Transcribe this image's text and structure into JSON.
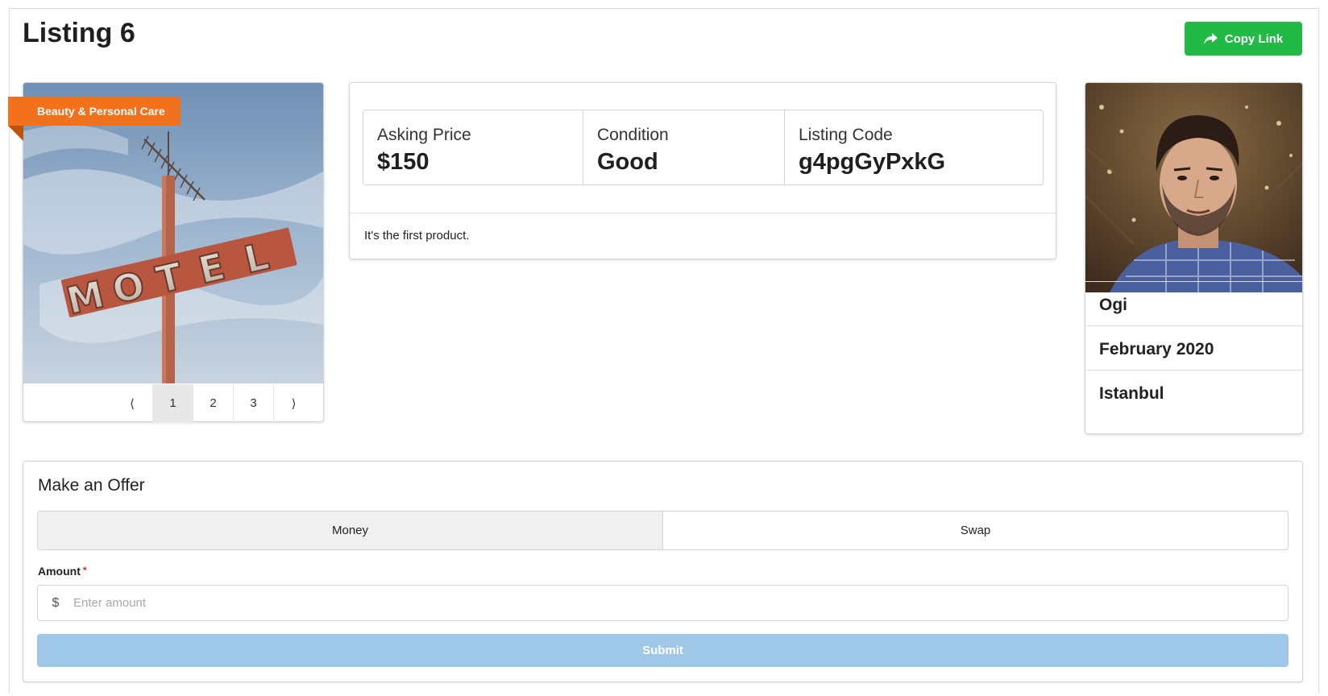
{
  "header": {
    "title": "Listing 6",
    "copy_link_label": "Copy Link",
    "copy_link_icon": "share-arrow-icon"
  },
  "colors": {
    "accent_green": "#21ba45",
    "ribbon_orange": "#f2711c",
    "submit_disabled_blue": "#9fc8e8"
  },
  "gallery": {
    "category": "Beauty & Personal Care",
    "image_description": "Vintage MOTEL sign on a pole against a blue sky",
    "pagination": {
      "prev": "⟨",
      "pages": [
        "1",
        "2",
        "3"
      ],
      "next": "⟩",
      "active_page": "1"
    }
  },
  "details": {
    "stats": [
      {
        "label": "Asking Price",
        "value": "$150"
      },
      {
        "label": "Condition",
        "value": "Good"
      },
      {
        "label": "Listing Code",
        "value": "g4pgGyPxkG"
      }
    ],
    "description": "It's the first product."
  },
  "seller": {
    "name": "Ogi",
    "joined": "February 2020",
    "location": "Istanbul"
  },
  "offer": {
    "title": "Make an Offer",
    "tabs": [
      {
        "label": "Money",
        "active": true
      },
      {
        "label": "Swap",
        "active": false
      }
    ],
    "amount_label": "Amount",
    "required_mark": "*",
    "currency_symbol": "$",
    "amount_value": "",
    "amount_placeholder": "Enter amount",
    "submit_label": "Submit"
  }
}
